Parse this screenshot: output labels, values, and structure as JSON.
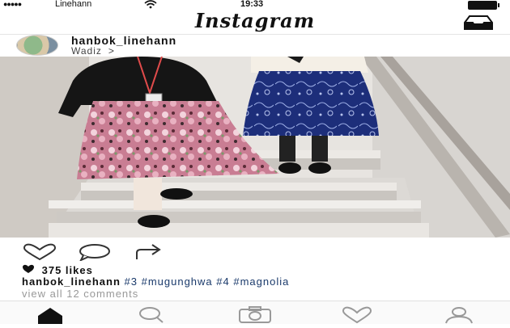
{
  "status": {
    "carrier": "Linehann",
    "time": "19:33"
  },
  "header": {
    "title": "Instagram",
    "inbox_icon": "inbox-icon"
  },
  "post": {
    "username": "hanbok_linehann",
    "location": "Wadiz",
    "location_chevron": ">",
    "likes_count": "375 likes",
    "caption_user": "hanbok_linehann",
    "caption_tags": "#3 #mugunghwa #4 #magnolia",
    "comments_link": "view all 12 comments"
  },
  "actions": [
    "heart-icon",
    "comment-icon",
    "share-icon"
  ],
  "tabs": [
    "home-icon",
    "search-icon",
    "camera-icon",
    "activity-heart-icon",
    "profile-icon"
  ],
  "colors": {
    "hashtag": "#1a3a6b",
    "text": "#111111",
    "muted": "#999999"
  }
}
